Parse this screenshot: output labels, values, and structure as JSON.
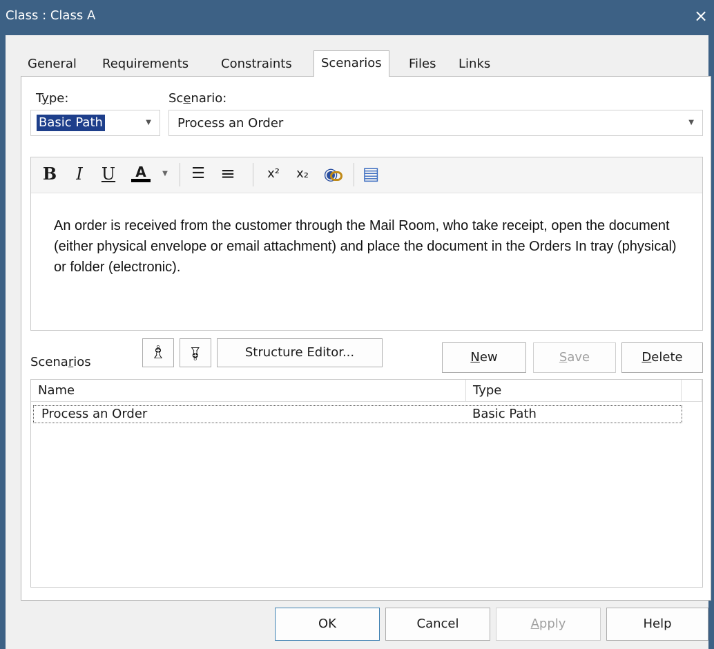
{
  "window": {
    "title": "Class : Class A",
    "close_glyph": "×"
  },
  "tabs": [
    {
      "label": "General"
    },
    {
      "label": "Requirements"
    },
    {
      "label": "Constraints"
    },
    {
      "label": "Scenarios",
      "active": true
    },
    {
      "label": "Files"
    },
    {
      "label": "Links"
    }
  ],
  "type_field": {
    "label_pre": "T",
    "label_ul": "y",
    "label_post": "pe:",
    "value": "Basic Path"
  },
  "scenario_field": {
    "label_pre": "Sc",
    "label_ul": "e",
    "label_post": "nario:",
    "value": "Process an Order"
  },
  "toolbar": {
    "bold": "B",
    "italic": "I",
    "underline": "U",
    "font_color": "A",
    "bullets": "☰",
    "numbering": "≡",
    "superscript": "x²",
    "subscript": "x₂",
    "hyperlink": "◉",
    "document": "▤"
  },
  "description": "An order is received from the customer through the Mail Room, who take receipt, open the document (either physical envelope or email attachment) and place the document in the Orders In tray (physical) or folder (electronic).",
  "scenarios_section": {
    "label_pre": "Scena",
    "label_ul": "r",
    "label_post": "ios",
    "move_up_glyph": "♗",
    "move_down_glyph": "♗",
    "structure_editor": "Structure Editor...",
    "new_ul": "N",
    "new_rest": "ew",
    "save_ul": "S",
    "save_rest": "ave",
    "delete_ul": "D",
    "delete_rest": "elete"
  },
  "table": {
    "columns": [
      "Name",
      "Type"
    ],
    "rows": [
      {
        "name": "Process an Order",
        "type": "Basic Path"
      }
    ]
  },
  "footer": {
    "ok": "OK",
    "cancel": "Cancel",
    "apply_ul": "A",
    "apply_rest": "pply",
    "help": "Help"
  },
  "colors": {
    "titlebar": "#3d6185",
    "selection": "#1e3f8b"
  }
}
